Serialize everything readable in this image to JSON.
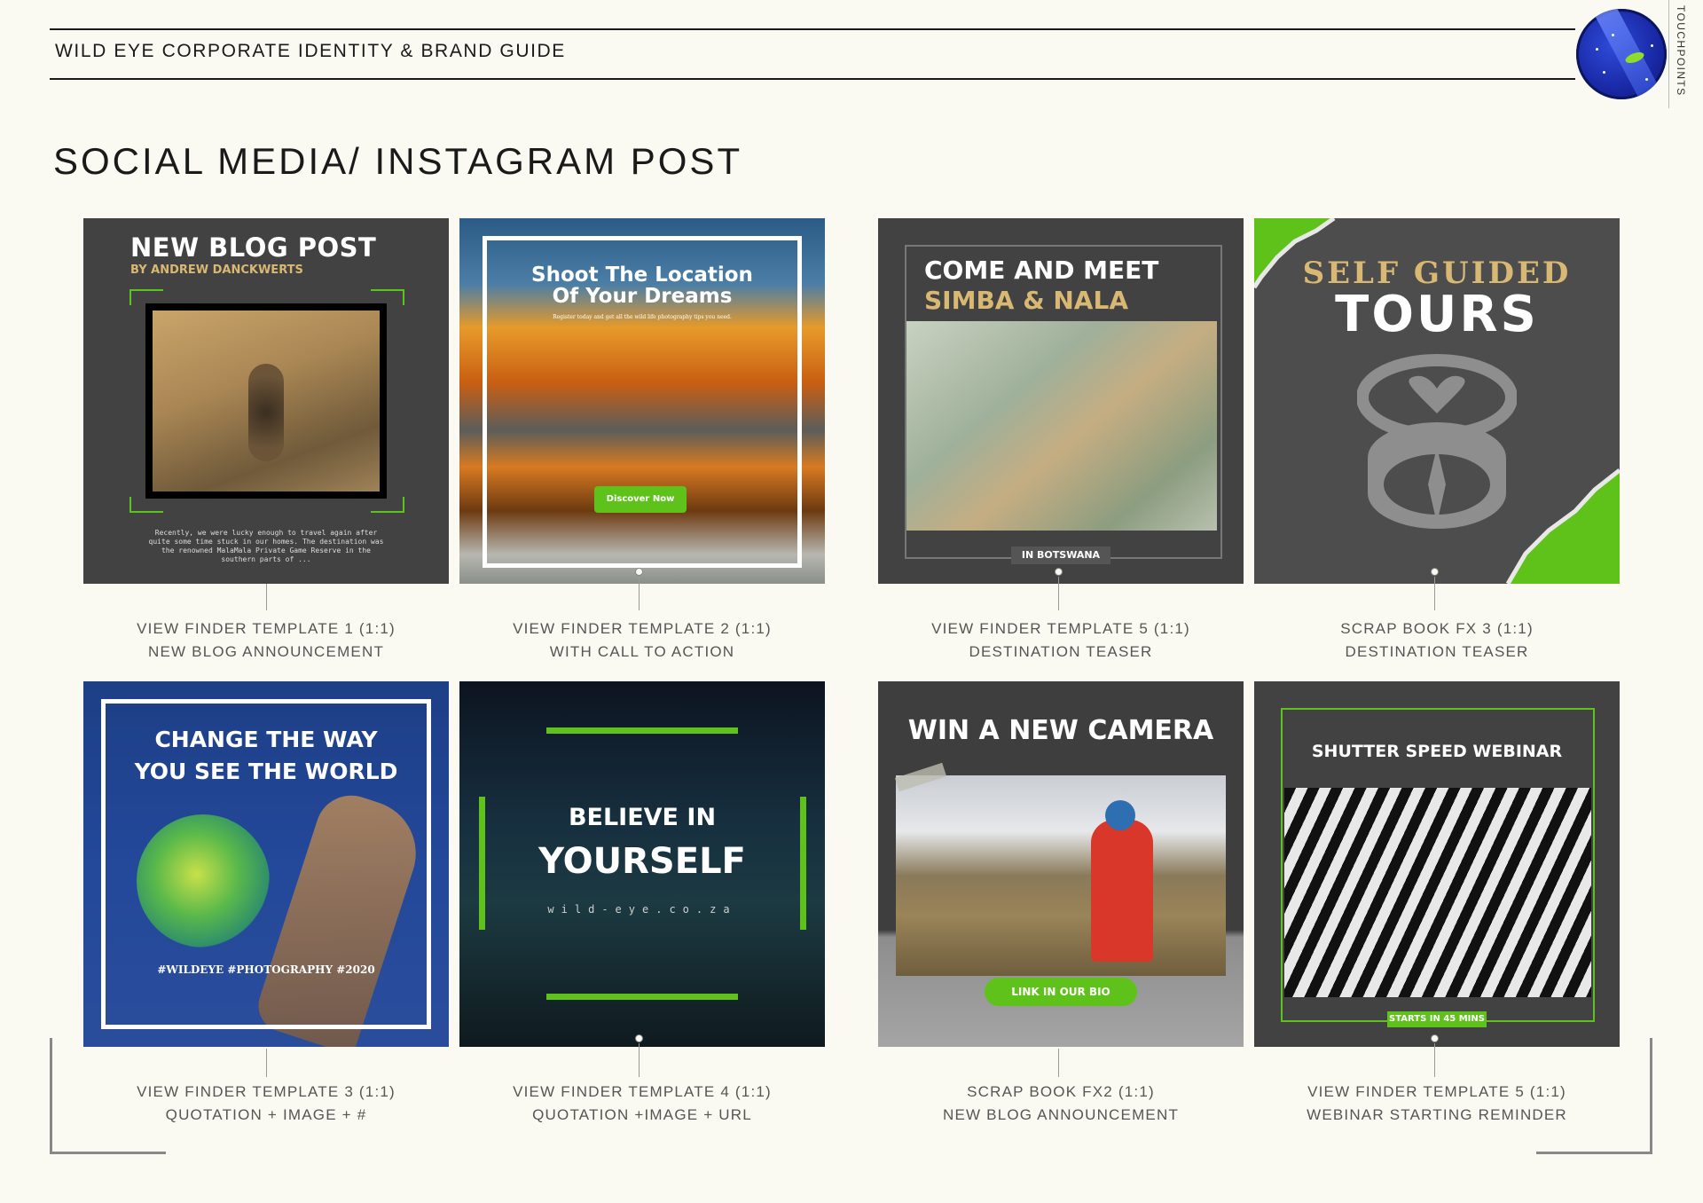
{
  "header": {
    "doc_title": "WILD EYE CORPORATE IDENTITY & BRAND GUIDE",
    "side_tab": "TOUCHPOINTS",
    "page_title": "SOCIAL MEDIA/ INSTAGRAM POST",
    "logo_icon": "wild-eye-logo"
  },
  "colors": {
    "brand_green": "#5fc21b",
    "charcoal": "#424242",
    "gold": "#d8b872",
    "logo_blue": "#1a2aa8"
  },
  "posts": [
    {
      "headline": "NEW BLOG POST",
      "subline": "BY ANDREW DANCKWERTS",
      "body": "Recently, we were lucky enough to travel again after quite some time stuck in our homes. The destination was the renowned MalaMala Private Game Reserve in the southern parts of ...",
      "caption_line1": "VIEW FINDER TEMPLATE 1 (1:1)",
      "caption_line2": "NEW BLOG ANNOUNCEMENT"
    },
    {
      "headline_line1": "Shoot The Location",
      "headline_line2": "Of Your Dreams",
      "subline": "Register today and get all the wild life photography tips you need.",
      "cta": "Discover Now",
      "caption_line1": "VIEW FINDER TEMPLATE 2 (1:1)",
      "caption_line2": "WITH CALL TO ACTION"
    },
    {
      "headline_line1": "COME AND MEET",
      "headline_line2": "SIMBA & NALA",
      "tag": "IN BOTSWANA",
      "caption_line1": "VIEW FINDER TEMPLATE 5 (1:1)",
      "caption_line2": "DESTINATION TEASER"
    },
    {
      "headline_line1": "SELF GUIDED",
      "headline_line2": "TOURS",
      "icon": "compass-icon",
      "caption_line1": "SCRAP BOOK FX 3 (1:1)",
      "caption_line2": "DESTINATION TEASER"
    },
    {
      "headline_line1": "CHANGE THE WAY",
      "headline_line2": "YOU SEE THE WORLD",
      "hashtags": "#WILDEYE #PHOTOGRAPHY #2020",
      "caption_line1": "VIEW FINDER TEMPLATE 3 (1:1)",
      "caption_line2": "QUOTATION + IMAGE + #"
    },
    {
      "headline_line1": "BELIEVE IN",
      "headline_line2": "YOURSELF",
      "url": "wild-eye.co.za",
      "caption_line1": "VIEW FINDER TEMPLATE 4 (1:1)",
      "caption_line2": "QUOTATION +IMAGE + URL"
    },
    {
      "headline": "WIN A NEW CAMERA",
      "cta": "LINK IN OUR BIO",
      "caption_line1": "SCRAP BOOK FX2 (1:1)",
      "caption_line2": "NEW BLOG ANNOUNCEMENT"
    },
    {
      "headline": "SHUTTER SPEED WEBINAR",
      "tag": "STARTS IN 45 MINS",
      "caption_line1": "VIEW FINDER TEMPLATE 5 (1:1)",
      "caption_line2": "WEBINAR STARTING REMINDER"
    }
  ]
}
